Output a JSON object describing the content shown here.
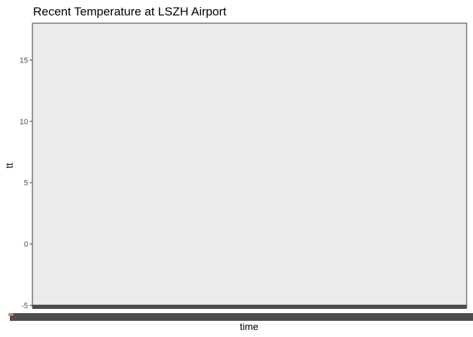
{
  "chart_data": {
    "type": "line",
    "title": "Recent Temperature at LSZH Airport",
    "xlabel": "time",
    "ylabel": "tt",
    "ylim": [
      -5,
      18
    ],
    "y_ticks": [
      15,
      10,
      5,
      0,
      -5
    ],
    "grid": false,
    "legend": "none",
    "series": [],
    "colors": {
      "panel_background": "#EBEBEB",
      "panel_border": "#333333",
      "overplotted_baseline": "#4D4D4D",
      "tick_text": "#4D4D4D"
    }
  }
}
